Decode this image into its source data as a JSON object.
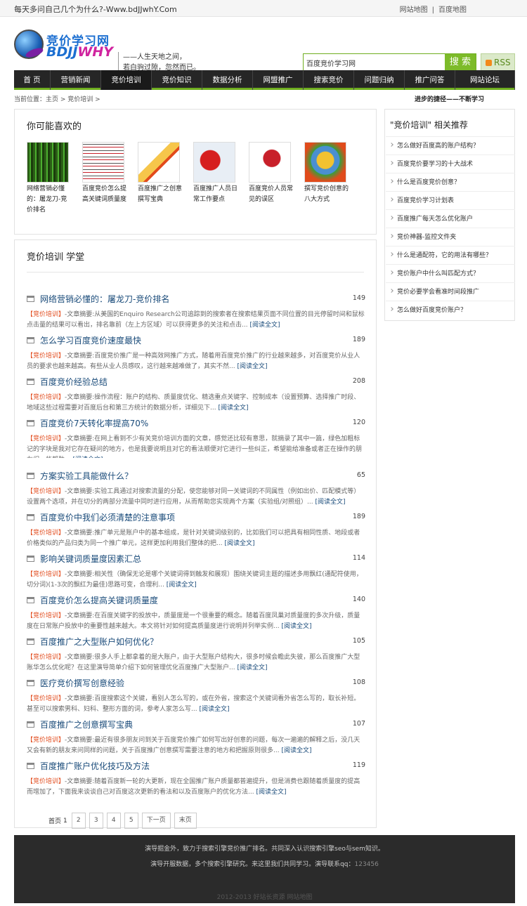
{
  "topbar": {
    "slogan": "每天多问自己几个为什么?-Www.bdJJwhY.Com",
    "links": [
      "网站地图",
      "百度地图"
    ]
  },
  "logo": {
    "line1": "竞价学习网",
    "line2a": "BDJJ",
    "line2b": "WHY"
  },
  "motto": {
    "line1": "——人生天地之间，",
    "line2": "若白驹过隙，忽然而已。"
  },
  "search": {
    "value": "百度竞价学习网",
    "button": "搜 索"
  },
  "rss": "RSS",
  "nav": [
    {
      "label": "首 页",
      "w": 52
    },
    {
      "label": "营销新闻",
      "w": 72
    },
    {
      "label": "竞价培训",
      "w": 72
    },
    {
      "label": "竞价知识",
      "w": 72
    },
    {
      "label": "数据分析",
      "w": 72
    },
    {
      "label": "网盟推广",
      "w": 72
    },
    {
      "label": "搜索竞价",
      "w": 72
    },
    {
      "label": "问题归纳",
      "w": 72
    },
    {
      "label": "推广问答",
      "w": 72
    },
    {
      "label": "网站论坛",
      "w": 85
    }
  ],
  "breadcrumb": "当前位置：主页 > 竞价培训 >",
  "tagline": "进步的捷径——不断学习",
  "like": {
    "title": "你可能喜欢的",
    "items": [
      "网络营销必懂的：屠龙刀-竞价排名",
      "百度竞价怎么提高关键词质量度",
      "百度推广之创意撰写宝典",
      "百度推广人员日常工作要点",
      "百度竞价人员常见的误区",
      "撰写竞价创意的八大方式"
    ]
  },
  "learn": {
    "title": "竞价培训  学堂",
    "category": "【竞价培训】",
    "more": "[阅读全文]",
    "posts": [
      {
        "title": "网络营销必懂的：屠龙刀-竞价排名",
        "count": "149",
        "summary": "-文章摘要:从美国的Enquiro Research公司追踪到的搜索者在搜索结果页面不同位置的目光停留时间和鼠标点击量的结果可以看出，排名靠前（左上方区域）可以获得更多的关注和点击..."
      },
      {
        "title": "怎么学习百度竞价速度最快",
        "count": "189",
        "summary": "-文章摘要:百度竞价推广是一种高效网推广方式，随着用百度竞价推广的行业越来越多，对百度竞价从业人员的要求也越来越高。有些从业人员感叹，这行越来越难做了，其实不然..."
      },
      {
        "title": "百度竞价经验总结",
        "count": "208",
        "summary": "-文章摘要:操作流程：账户的结构、质量度优化、精选重点关键字、控制成本（设置预算、选择推广时段、地域这些过程需要对百度后台和第三方统计的数据分析，详细见下..."
      },
      {
        "title": "百度竞价7天转化率提高70%",
        "count": "120",
        "summary": "-文章摘要:在网上看到不少有关竞价培训方面的文章，感觉还比较有意思，就摘录了其中一篇，绿色加粗标记的字块是我对它存在疑问的地方，也是我要说明且对它的看法顺便对它进行一些纠正，希望能给准备或者正在操作的朋友们一些帮助..."
      },
      {
        "title": "方案实验工具能做什么？",
        "count": "65",
        "summary": "-文章摘要:实验工具通过对搜索流量的分配，使您能够对同一关键词的不同属性（例如出价、匹配模式等）设置两个选项，并在切分的两部分流量中同时进行应用，从而帮助您实现两个方案（实验组/对照组）..."
      },
      {
        "title": "百度竞价中我们必须清楚的注意事项",
        "count": "189",
        "summary": "-文章摘要:推广单元是账户中的基本组成，是针对关键词级别的，比如我们可以把具有相同性质、地段或者价格类似的产品归类为同一个推广单元，这样更加利用我们整体的把..."
      },
      {
        "title": "影响关键词质量度因素汇总",
        "count": "114",
        "summary": "-文章摘要:相关性（确保无论是哪个关键词得到触发和展现）围绕关键词主题的描述多用飘红(通配符使用，切分词)(1-3次的飘红为最佳)思路可变，合理利..."
      },
      {
        "title": "百度竞价怎么提高关键词质量度",
        "count": "140",
        "summary": "-文章摘要:在百度关键字的投放中，质量度是一个很重要的概念。随着百度凤巢对质量度的多次升级，质量度在日常账户投放中的重要性越来越大。本文将针对如何提高质量度进行说明并列举实例..."
      },
      {
        "title": "百度推广之大型账户如何优化？",
        "count": "105",
        "summary": "-文章摘要:很多人手上都拿着的是大账户，由于大型账户结构大，很多时候会瞻此失彼，那么百度推广大型账华怎么优化呢？在这里演导简单介绍下如何管理优化百度推广大型账户..."
      },
      {
        "title": "医疗竞价撰写创意经验",
        "count": "108",
        "summary": "-文章摘要:百度搜索这个关键，看别人怎么写的，或在外省，搜索这个关键词看外省怎么写的，取长补短。甚至可以搜索男科、妇科、整形方面的词，参考人家怎么写..."
      },
      {
        "title": "百度推广之创意撰写宝典",
        "count": "107",
        "summary": "-文章摘要:最近有很多朋友问到关于百度竞价推广如何写出好创意的问题，每次一遍遍的解释之后，没几天又会有新的朋友来问同样的问题，关于百度推广创意撰写需要注意的地方和把握原则很多..."
      },
      {
        "title": "百度推广账户优化技巧及方法",
        "count": "119",
        "summary": "-文章摘要:随着百度新一轮的大更新，现在全国推广账户质量都普遍提升，但是消费也跟随着质量度的提高而增加了，下面我来谈谈自己对百度这次更新的看法和以及百度账户的优化方法..."
      }
    ]
  },
  "pager": {
    "first": "首页",
    "current": "1",
    "pages": [
      "2",
      "3",
      "4",
      "5"
    ],
    "next": "下一页",
    "last": "末页"
  },
  "sidebar": {
    "title": "\"竞价培训\" 相关推荐",
    "items": [
      "怎么做好百度高的账户结构？",
      "百度竞价要学习的十大战术",
      "什么是百度竞价创意？",
      "百度竞价学习计划表",
      "百度推广每天怎么优化账户",
      "竞价神器-监控文件夹",
      "什么是通配符，它的用法有哪些？",
      "竞价账户中什么叫匹配方式？",
      "竞价必要学会看准时间段推广",
      "怎么做好百度竞价账户？"
    ]
  },
  "footer": {
    "line1": "演导掘金外，致力于搜索引擎竞价推广排名。共同深入认识搜索引擎seo与sem知识。",
    "line2": "演导开服数据，多个搜索引擎研究。来这里我们共同学习。演导联系qq：",
    "qq": "123456",
    "copy": "2012-2013 好站长资源 网站地图"
  },
  "colors": {
    "accent": "#7dbb2a",
    "nav_bg": "#262626",
    "link": "#1a4b7a",
    "category": "#e24a1b"
  }
}
